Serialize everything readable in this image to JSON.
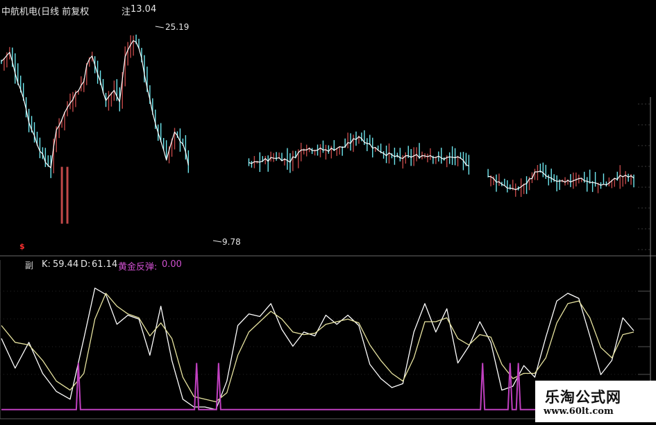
{
  "header": {
    "title": "中航机电(日线 前复权",
    "note_label": "注",
    "note_value": "13.04"
  },
  "price_panel": {
    "high_marker": "25.19",
    "low_marker": "9.78",
    "signal_glyph": "$"
  },
  "indicator_panel": {
    "icon_glyph": "副",
    "k_label": "K:",
    "k_value": "59.44",
    "d_label": "D:",
    "d_value": "61.14",
    "signal_label": "黄金反弹:",
    "signal_value": "0.00"
  },
  "watermark": {
    "line1": "乐淘公式网",
    "line2": "www.60lt.com"
  },
  "colors": {
    "background": "#000000",
    "up_candle": "#c04848",
    "down_candle": "#6fe8f0",
    "price_line": "#ffffff",
    "k_line": "#ffffff",
    "d_line": "#e8e4a0",
    "signal_line": "#c040c0",
    "signal_label": "#d050d0",
    "grid": "#3a3a3a"
  },
  "chart_data": [
    {
      "type": "line",
      "panel": "price",
      "x_count": 232,
      "ylim": [
        7.5,
        27.5
      ],
      "segments": [
        {
          "x_start": 0,
          "x_end": 68,
          "ref_x": [
            0,
            3,
            6,
            8,
            10,
            13,
            16,
            18,
            20,
            25,
            30,
            31,
            33,
            38,
            41,
            43,
            45,
            48,
            50,
            52,
            55,
            60,
            63,
            66,
            68
          ],
          "ref_y": [
            23.5,
            24.2,
            21.8,
            20.5,
            18.4,
            16.6,
            15.0,
            14.6,
            17.7,
            20.1,
            21.8,
            23.3,
            23.9,
            20.3,
            21.0,
            20.1,
            23.9,
            25.4,
            24.7,
            22.5,
            19.0,
            15.3,
            17.4,
            16.6,
            14.8
          ]
        },
        {
          "x_start": 90,
          "x_end": 170,
          "ref_x": [
            90,
            95,
            100,
            105,
            110,
            118,
            125,
            130,
            135,
            140,
            145,
            150,
            156,
            160,
            165,
            170
          ],
          "ref_y": [
            14.8,
            15.1,
            15.4,
            15.1,
            16.2,
            16.0,
            16.3,
            17.2,
            16.3,
            15.7,
            15.3,
            15.5,
            15.6,
            15.3,
            15.4,
            14.8
          ]
        },
        {
          "x_start": 177,
          "x_end": 230,
          "ref_x": [
            177,
            182,
            186,
            190,
            195,
            200,
            205,
            210,
            215,
            220,
            225,
            230
          ],
          "ref_y": [
            13.8,
            13.2,
            12.6,
            13.0,
            14.3,
            13.5,
            13.2,
            13.7,
            13.2,
            13.1,
            13.8,
            13.7
          ]
        }
      ],
      "annotations": [
        {
          "text": "25.19",
          "x": 56
        },
        {
          "text": "9.78",
          "x": 77
        }
      ]
    },
    {
      "type": "line",
      "panel": "indicator",
      "x_count": 232,
      "ylim": [
        -5,
        105
      ],
      "series": [
        {
          "legend_ref": "K",
          "x": [
            0,
            5,
            10,
            15,
            20,
            25,
            30,
            34,
            38,
            42,
            46,
            50,
            54,
            58,
            62,
            66,
            70,
            74,
            78,
            82,
            86,
            90,
            94,
            98,
            102,
            106,
            110,
            114,
            118,
            122,
            126,
            130,
            134,
            138,
            142,
            146,
            150,
            154,
            158,
            162,
            166,
            170,
            174,
            178,
            182,
            186,
            190,
            194,
            198,
            202,
            206,
            210,
            214,
            218,
            222,
            226,
            230
          ],
          "y": [
            55,
            32,
            52,
            28,
            14,
            8,
            55,
            94,
            89,
            66,
            73,
            70,
            42,
            80,
            38,
            8,
            2,
            2,
            0,
            22,
            65,
            74,
            72,
            82,
            62,
            49,
            60,
            57,
            73,
            66,
            73,
            65,
            35,
            24,
            17,
            20,
            60,
            82,
            60,
            78,
            36,
            49,
            68,
            52,
            15,
            18,
            34,
            25,
            56,
            84,
            90,
            86,
            57,
            27,
            38,
            71,
            61
          ]
        },
        {
          "legend_ref": "D",
          "x": [
            0,
            5,
            10,
            15,
            20,
            25,
            30,
            34,
            38,
            42,
            46,
            50,
            54,
            58,
            62,
            66,
            70,
            74,
            78,
            82,
            86,
            90,
            94,
            98,
            102,
            106,
            110,
            114,
            118,
            122,
            126,
            130,
            134,
            138,
            142,
            146,
            150,
            154,
            158,
            162,
            166,
            170,
            174,
            178,
            182,
            186,
            190,
            194,
            198,
            202,
            206,
            210,
            214,
            218,
            222,
            226,
            230
          ],
          "y": [
            65,
            52,
            50,
            38,
            22,
            15,
            28,
            70,
            90,
            80,
            74,
            71,
            57,
            67,
            55,
            25,
            10,
            8,
            6,
            13,
            42,
            60,
            68,
            76,
            70,
            60,
            58,
            59,
            66,
            68,
            70,
            67,
            50,
            38,
            28,
            22,
            40,
            68,
            68,
            71,
            55,
            50,
            58,
            56,
            35,
            24,
            28,
            28,
            40,
            67,
            82,
            84,
            71,
            48,
            40,
            58,
            60
          ]
        },
        {
          "legend_ref": "黄金反弹",
          "baseline": 0,
          "spikes": [
            {
              "x": 28,
              "value": 36
            },
            {
              "x": 71,
              "value": 36
            },
            {
              "x": 79,
              "value": 36
            },
            {
              "x": 175,
              "value": 36
            },
            {
              "x": 185,
              "value": 36
            },
            {
              "x": 188,
              "value": 36
            }
          ]
        }
      ]
    }
  ]
}
